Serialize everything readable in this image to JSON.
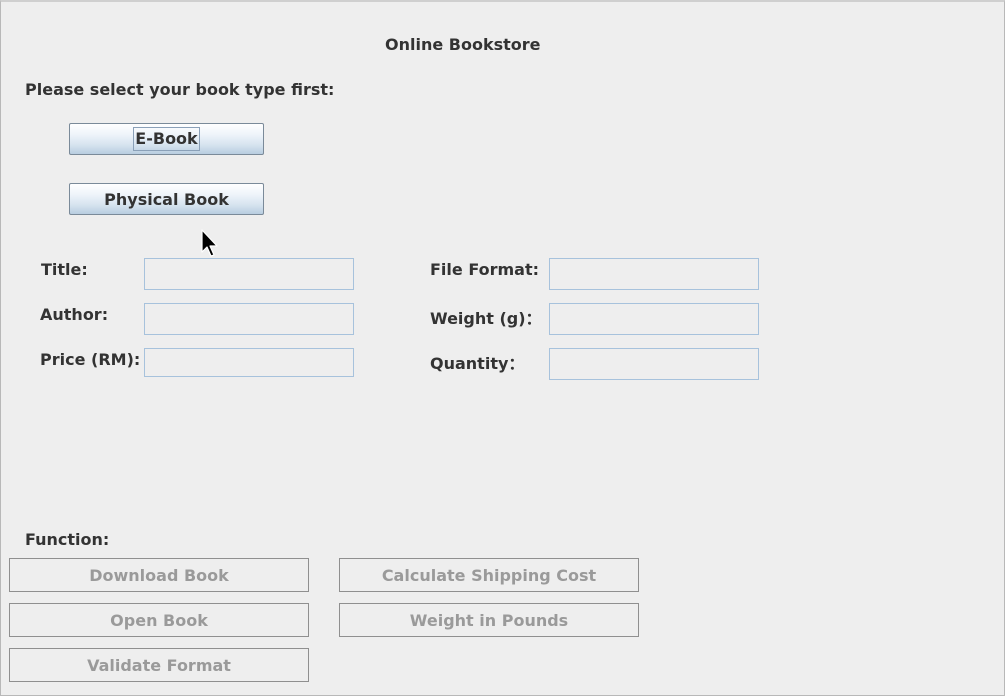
{
  "app": {
    "title": "Online Bookstore"
  },
  "book_type": {
    "prompt": "Please select your book type first:",
    "ebook_label": "E-Book",
    "physical_label": "Physical Book"
  },
  "fields": {
    "title_label": "Title:",
    "author_label": "Author:",
    "price_label": "Price (RM):",
    "file_format_label": "File Format:",
    "weight_label": "Weight (g)：",
    "quantity_label": "Quantity：",
    "title_value": "",
    "author_value": "",
    "price_value": "",
    "file_format_value": "",
    "weight_value": "",
    "quantity_value": ""
  },
  "functions": {
    "heading": "Function:",
    "download_label": "Download Book",
    "open_label": "Open Book",
    "validate_label": "Validate Format",
    "shipping_label": "Calculate Shipping Cost",
    "pounds_label": "Weight in Pounds"
  },
  "cursor": {
    "icon": "arrow-pointer-icon"
  }
}
